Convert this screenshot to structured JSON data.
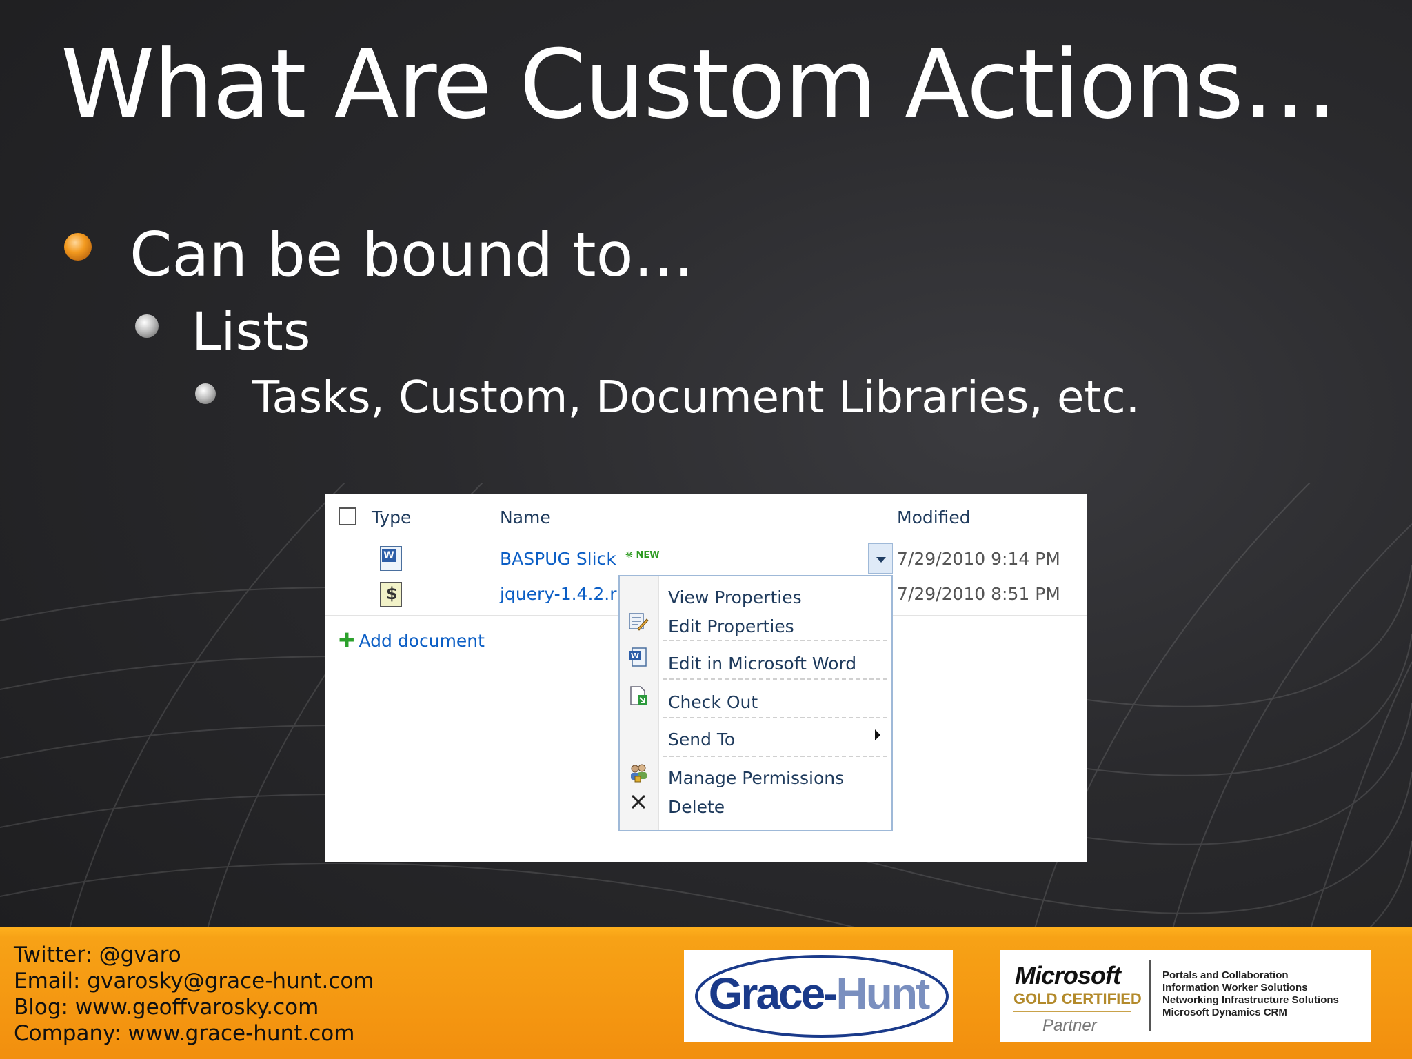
{
  "slide": {
    "title": "What Are Custom Actions…",
    "bullet1": "Can be bound to…",
    "bullet2": "Lists",
    "bullet3": "Tasks, Custom, Document Libraries, etc."
  },
  "library": {
    "col_type": "Type",
    "col_name": "Name",
    "col_modified": "Modified",
    "rows": [
      {
        "name": "BASPUG Slick",
        "badge": "NEW",
        "modified": "7/29/2010 9:14 PM",
        "icon": "word-doc-icon"
      },
      {
        "name": "jquery-1.4.2.r",
        "modified": "7/29/2010 8:51 PM",
        "icon": "script-file-icon"
      }
    ],
    "add_document": "Add document",
    "menu": [
      {
        "label": "View Properties"
      },
      {
        "label": "Edit Properties",
        "icon": "edit-properties-icon"
      },
      {
        "label": "Edit in Microsoft Word",
        "icon": "word-doc-icon"
      },
      {
        "label": "Check Out",
        "icon": "check-out-icon"
      },
      {
        "label": "Send To",
        "icon": "submenu-arrow-icon"
      },
      {
        "label": "Manage Permissions",
        "icon": "permissions-icon"
      },
      {
        "label": "Delete",
        "icon": "delete-x-icon"
      }
    ]
  },
  "footer": {
    "twitter": "Twitter: @gvaro",
    "email": "Email: gvarosky@grace-hunt.com",
    "blog": "Blog: www.geoffvarosky.com",
    "company": "Company: www.grace-hunt.com",
    "logo1_a": "Grace",
    "logo1_dash": "-",
    "logo1_b": "Hunt",
    "ms_word": "Microsoft",
    "ms_gold": "GOLD CERTIFIED",
    "ms_partner": "Partner",
    "ms_competencies": [
      "Portals and Collaboration",
      "Information Worker Solutions",
      "Networking Infrastructure Solutions",
      "Microsoft Dynamics CRM"
    ]
  },
  "colors": {
    "footer_orange": "#f7a216",
    "link_blue": "#0b5ec5",
    "background_dark": "#2a2a2d"
  }
}
